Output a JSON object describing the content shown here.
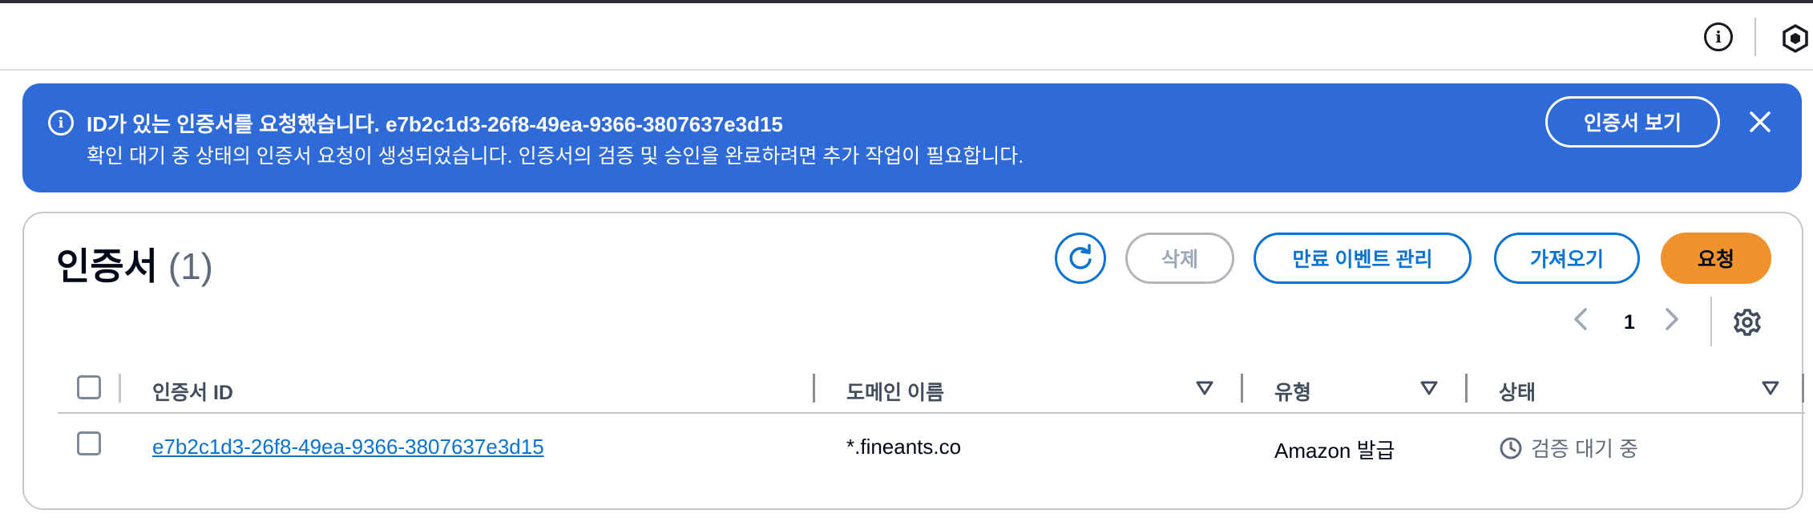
{
  "topbar": {
    "info_icon": "info-icon",
    "hex_icon": "cloudshell-icon"
  },
  "flash": {
    "icon": "info-icon",
    "title": "ID가 있는 인증서를 요청했습니다. e7b2c1d3-26f8-49ea-9366-3807637e3d15",
    "description": "확인 대기 중 상태의 인증서 요청이 생성되었습니다. 인증서의 검증 및 승인을 완료하려면 추가 작업이 필요합니다.",
    "view_button": "인증서 보기",
    "close_icon": "close-icon",
    "color": "#2f6ad9"
  },
  "panel": {
    "title": "인증서",
    "count": "(1)",
    "actions": {
      "refresh_icon": "refresh-icon",
      "delete": "삭제",
      "manage_expiry": "만료 이벤트 관리",
      "import": "가져오기",
      "request": "요청"
    },
    "pagination": {
      "page": "1",
      "prev_icon": "chevron-left-icon",
      "next_icon": "chevron-right-icon"
    },
    "settings_icon": "gear-icon",
    "columns": [
      "인증서 ID",
      "도메인 이름",
      "유형",
      "상태"
    ],
    "rows": [
      {
        "id": "e7b2c1d3-26f8-49ea-9366-3807637e3d15",
        "domain": "*.fineants.co",
        "type": "Amazon 발급",
        "status": "검증 대기 중",
        "status_icon": "clock-icon"
      }
    ],
    "accent_color": "#0972d3",
    "primary_color": "#f0922b"
  }
}
